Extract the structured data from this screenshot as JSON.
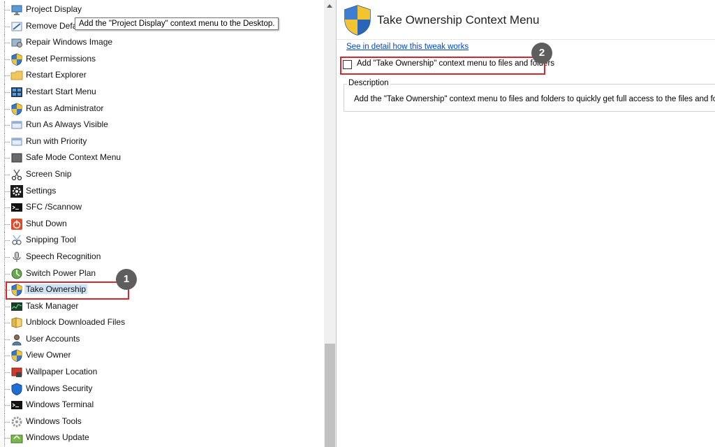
{
  "tooltip": {
    "text": "Add the \"Project Display\" context menu to the Desktop."
  },
  "tree": {
    "items": [
      {
        "label": "Project Display",
        "icon": "monitor-icon"
      },
      {
        "label": "Remove Default",
        "icon": "remove-icon"
      },
      {
        "label": "Repair Windows Image",
        "icon": "repair-icon"
      },
      {
        "label": "Reset Permissions",
        "icon": "shield-icon"
      },
      {
        "label": "Restart Explorer",
        "icon": "folder-icon"
      },
      {
        "label": "Restart Start Menu",
        "icon": "start-menu-icon"
      },
      {
        "label": "Run as Administrator",
        "icon": "shield-icon"
      },
      {
        "label": "Run As Always Visible",
        "icon": "window-icon"
      },
      {
        "label": "Run with Priority",
        "icon": "window-icon"
      },
      {
        "label": "Safe Mode Context Menu",
        "icon": "safe-mode-icon"
      },
      {
        "label": "Screen Snip",
        "icon": "scissors-icon"
      },
      {
        "label": "Settings",
        "icon": "gear-icon"
      },
      {
        "label": "SFC /Scannow",
        "icon": "terminal-icon"
      },
      {
        "label": "Shut Down",
        "icon": "power-icon"
      },
      {
        "label": "Snipping Tool",
        "icon": "snipping-tool-icon"
      },
      {
        "label": "Speech Recognition",
        "icon": "microphone-icon"
      },
      {
        "label": "Switch Power Plan",
        "icon": "power-plan-icon"
      },
      {
        "label": "Take Ownership",
        "icon": "shield-icon",
        "selected": true
      },
      {
        "label": "Task Manager",
        "icon": "task-manager-icon"
      },
      {
        "label": "Unblock Downloaded Files",
        "icon": "unblock-icon"
      },
      {
        "label": "User Accounts",
        "icon": "user-icon"
      },
      {
        "label": "View Owner",
        "icon": "shield-icon"
      },
      {
        "label": "Wallpaper Location",
        "icon": "wallpaper-icon"
      },
      {
        "label": "Windows Security",
        "icon": "security-shield-icon"
      },
      {
        "label": "Windows Terminal",
        "icon": "terminal-icon"
      },
      {
        "label": "Windows Tools",
        "icon": "tools-icon"
      },
      {
        "label": "Windows Update",
        "icon": "update-icon"
      }
    ]
  },
  "annotations": {
    "badge1": "1",
    "badge2": "2",
    "color": "#d9262e"
  },
  "right": {
    "title": "Take Ownership Context Menu",
    "link": "See in detail how this tweak works",
    "checkbox_label": "Add \"Take Ownership\" context menu to files and folders",
    "checkbox_checked": false,
    "description_title": "Description",
    "description_text": "Add the \"Take Ownership\" context menu to files and folders to quickly get full access to the files and folders."
  }
}
